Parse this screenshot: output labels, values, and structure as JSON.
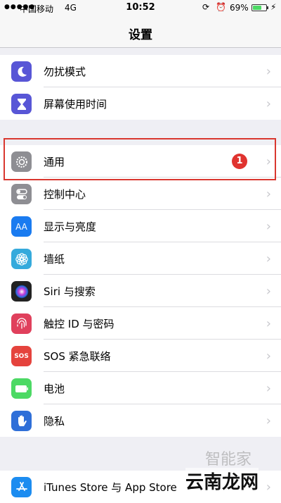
{
  "status": {
    "signal": "●●●●●",
    "carrier": "中国移动",
    "network": "4G",
    "time": "10:52",
    "rotation_lock_icon": "rotation-lock-icon",
    "alarm_icon": "alarm-icon",
    "battery_pct": "69%",
    "battery_level": 0.69
  },
  "nav": {
    "title": "设置"
  },
  "group1": [
    {
      "label": "勿扰模式",
      "icon": "moon-icon",
      "color": "#5856d6"
    },
    {
      "label": "屏幕使用时间",
      "icon": "hourglass-icon",
      "color": "#5856d6"
    }
  ],
  "group2": [
    {
      "label": "通用",
      "icon": "gear-icon",
      "color": "#8e8e93",
      "badge": "1"
    },
    {
      "label": "控制中心",
      "icon": "toggles-icon",
      "color": "#8e8e93"
    },
    {
      "label": "显示与亮度",
      "icon": "text-size-icon",
      "color": "#1a7bf0",
      "glyph": "AA"
    },
    {
      "label": "墙纸",
      "icon": "flower-icon",
      "color": "#35aadc"
    },
    {
      "label": "Siri 与搜索",
      "icon": "siri-icon",
      "color": "#222"
    },
    {
      "label": "触控 ID 与密码",
      "icon": "fingerprint-icon",
      "color": "#e0405c"
    },
    {
      "label": "SOS 紧急联络",
      "icon": "sos-icon",
      "color": "#e5433d",
      "glyph": "SOS"
    },
    {
      "label": "电池",
      "icon": "battery-icon",
      "color": "#4cd964"
    },
    {
      "label": "隐私",
      "icon": "hand-icon",
      "color": "#2f6fd8"
    }
  ],
  "group3": [
    {
      "label": "iTunes Store 与 App Store",
      "icon": "app-store-icon",
      "color": "#1c8cf0"
    }
  ],
  "watermark": {
    "top": "智能家",
    "bottom": "云南龙网"
  }
}
